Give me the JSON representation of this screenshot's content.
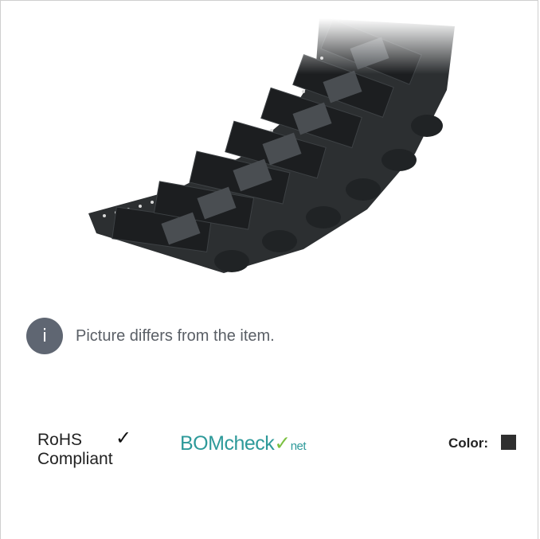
{
  "notice": {
    "icon": "info-icon",
    "icon_glyph": "i",
    "text": "Picture differs from the item."
  },
  "rohs": {
    "line1": "RoHS",
    "line2": "Compliant",
    "check_glyph": "✓"
  },
  "bomcheck": {
    "part1": "BOM",
    "part2": "check",
    "part3": "✓",
    "part4": "net"
  },
  "color": {
    "label": "Color:",
    "swatch": "#2f2f2f"
  },
  "colors": {
    "accent_teal": "#2e9a9a",
    "accent_green": "#7cc142",
    "badge_gray": "#5f6672"
  }
}
